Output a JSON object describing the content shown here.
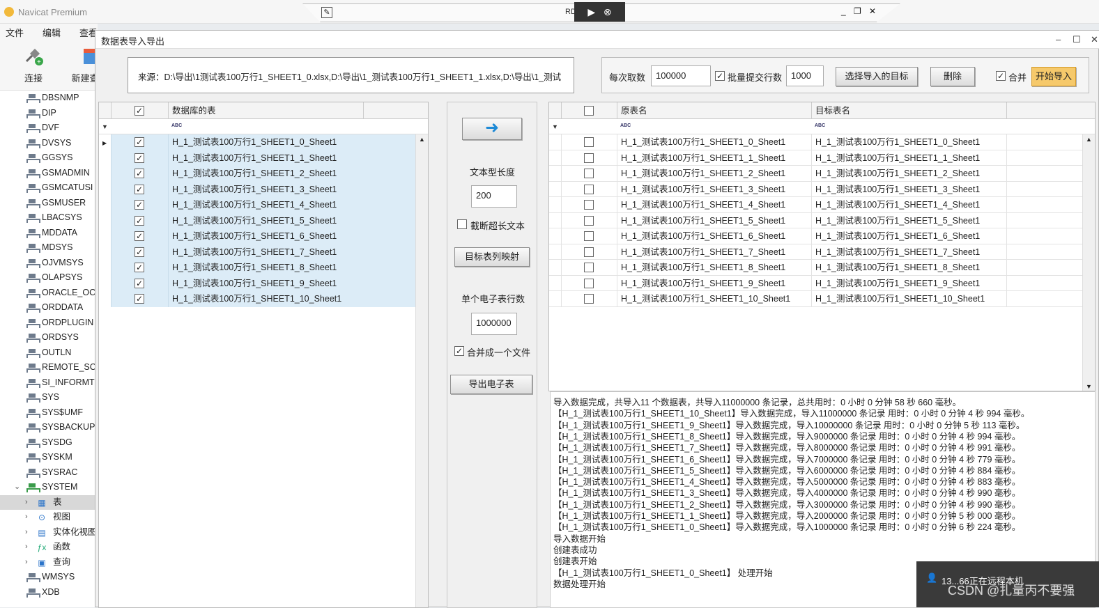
{
  "window": {
    "title": "Navicat Premium"
  },
  "rdp": {
    "title": "RD…2…49",
    "pin_icon": "pin-icon",
    "min": "_",
    "restore": "❐",
    "close": "✕"
  },
  "menu": [
    "文件",
    "编辑",
    "查看"
  ],
  "toolbar": {
    "connect": "连接",
    "new": "新建查"
  },
  "tree": {
    "schemas": [
      "DBSNMP",
      "DIP",
      "DVF",
      "DVSYS",
      "GGSYS",
      "GSMADMIN",
      "GSMCATUSI",
      "GSMUSER",
      "LBACSYS",
      "MDDATA",
      "MDSYS",
      "OJVMSYS",
      "OLAPSYS",
      "ORACLE_OC",
      "ORDDATA",
      "ORDPLUGIN",
      "ORDSYS",
      "OUTLN",
      "REMOTE_SC",
      "SI_INFORMT",
      "SYS",
      "SYS$UMF",
      "SYSBACKUP",
      "SYSDG",
      "SYSKM",
      "SYSRAC",
      "SYSTEM"
    ],
    "system_children": [
      "表",
      "视图",
      "实体化视图",
      "函数",
      "查询"
    ],
    "after": [
      "WMSYS",
      "XDB"
    ]
  },
  "dialog": {
    "title": "数据表导入导出",
    "source_label": "来源：D:\\导出\\1测试表100万行1_SHEET1_0.xlsx,D:\\导出\\1_测试表100万行1_SHEET1_1.xlsx,D:\\导出\\1_测试",
    "per_fetch_label": "每次取数",
    "per_fetch_value": "100000",
    "batch_label": "批量提交行数",
    "batch_checked": true,
    "batch_value": "1000",
    "choose_target_button": "选择导入的目标",
    "delete_button": "删除",
    "merge_label": "合并",
    "merge_checked": true,
    "start_button": "开始导入",
    "left_grid": {
      "col_header": "数据库的表",
      "filter_type": "ABC",
      "rows": [
        "H_1_测试表100万行1_SHEET1_0_Sheet1",
        "H_1_测试表100万行1_SHEET1_1_Sheet1",
        "H_1_测试表100万行1_SHEET1_2_Sheet1",
        "H_1_测试表100万行1_SHEET1_3_Sheet1",
        "H_1_测试表100万行1_SHEET1_4_Sheet1",
        "H_1_测试表100万行1_SHEET1_5_Sheet1",
        "H_1_测试表100万行1_SHEET1_6_Sheet1",
        "H_1_测试表100万行1_SHEET1_7_Sheet1",
        "H_1_测试表100万行1_SHEET1_8_Sheet1",
        "H_1_测试表100万行1_SHEET1_9_Sheet1",
        "H_1_测试表100万行1_SHEET1_10_Sheet1"
      ]
    },
    "middle": {
      "arrow": "➜",
      "text_len_label": "文本型长度",
      "text_len_value": "200",
      "truncate_label": "截断超长文本",
      "truncate_checked": false,
      "mapping_button": "目标表列映射",
      "rows_per_sheet_label": "单个电子表行数",
      "rows_per_sheet_value": "1000000",
      "merge_file_label": "合并成一个文件",
      "merge_file_checked": true,
      "export_button": "导出电子表"
    },
    "right_grid": {
      "col_source": "原表名",
      "col_target": "目标表名",
      "filter_type": "ABC",
      "rows": [
        [
          "H_1_测试表100万行1_SHEET1_0_Sheet1",
          "H_1_测试表100万行1_SHEET1_0_Sheet1"
        ],
        [
          "H_1_测试表100万行1_SHEET1_1_Sheet1",
          "H_1_测试表100万行1_SHEET1_1_Sheet1"
        ],
        [
          "H_1_测试表100万行1_SHEET1_2_Sheet1",
          "H_1_测试表100万行1_SHEET1_2_Sheet1"
        ],
        [
          "H_1_测试表100万行1_SHEET1_3_Sheet1",
          "H_1_测试表100万行1_SHEET1_3_Sheet1"
        ],
        [
          "H_1_测试表100万行1_SHEET1_4_Sheet1",
          "H_1_测试表100万行1_SHEET1_4_Sheet1"
        ],
        [
          "H_1_测试表100万行1_SHEET1_5_Sheet1",
          "H_1_测试表100万行1_SHEET1_5_Sheet1"
        ],
        [
          "H_1_测试表100万行1_SHEET1_6_Sheet1",
          "H_1_测试表100万行1_SHEET1_6_Sheet1"
        ],
        [
          "H_1_测试表100万行1_SHEET1_7_Sheet1",
          "H_1_测试表100万行1_SHEET1_7_Sheet1"
        ],
        [
          "H_1_测试表100万行1_SHEET1_8_Sheet1",
          "H_1_测试表100万行1_SHEET1_8_Sheet1"
        ],
        [
          "H_1_测试表100万行1_SHEET1_9_Sheet1",
          "H_1_测试表100万行1_SHEET1_9_Sheet1"
        ],
        [
          "H_1_测试表100万行1_SHEET1_10_Sheet1",
          "H_1_测试表100万行1_SHEET1_10_Sheet1"
        ]
      ]
    },
    "log": [
      "导入数据完成，共导入11 个数据表，共导入11000000 条记录，总共用时：0 小时 0 分钟 58 秒 660 毫秒。",
      "【H_1_测试表100万行1_SHEET1_10_Sheet1】导入数据完成，导入11000000 条记录 用时：0 小时 0 分钟 4 秒 994 毫秒。",
      "【H_1_测试表100万行1_SHEET1_9_Sheet1】导入数据完成，导入10000000 条记录 用时：0 小时 0 分钟 5 秒 113 毫秒。",
      "【H_1_测试表100万行1_SHEET1_8_Sheet1】导入数据完成，导入9000000 条记录 用时：0 小时 0 分钟 4 秒 994 毫秒。",
      "【H_1_测试表100万行1_SHEET1_7_Sheet1】导入数据完成，导入8000000 条记录 用时：0 小时 0 分钟 4 秒 991 毫秒。",
      "【H_1_测试表100万行1_SHEET1_6_Sheet1】导入数据完成，导入7000000 条记录 用时：0 小时 0 分钟 4 秒 779 毫秒。",
      "【H_1_测试表100万行1_SHEET1_5_Sheet1】导入数据完成，导入6000000 条记录 用时：0 小时 0 分钟 4 秒 884 毫秒。",
      "【H_1_测试表100万行1_SHEET1_4_Sheet1】导入数据完成，导入5000000 条记录 用时：0 小时 0 分钟 4 秒 883 毫秒。",
      "【H_1_测试表100万行1_SHEET1_3_Sheet1】导入数据完成，导入4000000 条记录 用时：0 小时 0 分钟 4 秒 990 毫秒。",
      "【H_1_测试表100万行1_SHEET1_2_Sheet1】导入数据完成，导入3000000 条记录 用时：0 小时 0 分钟 4 秒 990 毫秒。",
      "【H_1_测试表100万行1_SHEET1_1_Sheet1】导入数据完成，导入2000000 条记录 用时：0 小时 0 分钟 5 秒 000 毫秒。",
      "【H_1_测试表100万行1_SHEET1_0_Sheet1】导入数据完成，导入1000000 条记录 用时：0 小时 0 分钟 6 秒 224 毫秒。",
      " 导入数据开始",
      " 创建表成功",
      " 创建表开始",
      "【H_1_测试表100万行1_SHEET1_0_Sheet1】 处理开始",
      "数据处理开始"
    ]
  },
  "notification": {
    "text": "13...66正在远程本机",
    "user_icon": "user-icon"
  },
  "watermark": "CSDN @扎量丙不要强"
}
